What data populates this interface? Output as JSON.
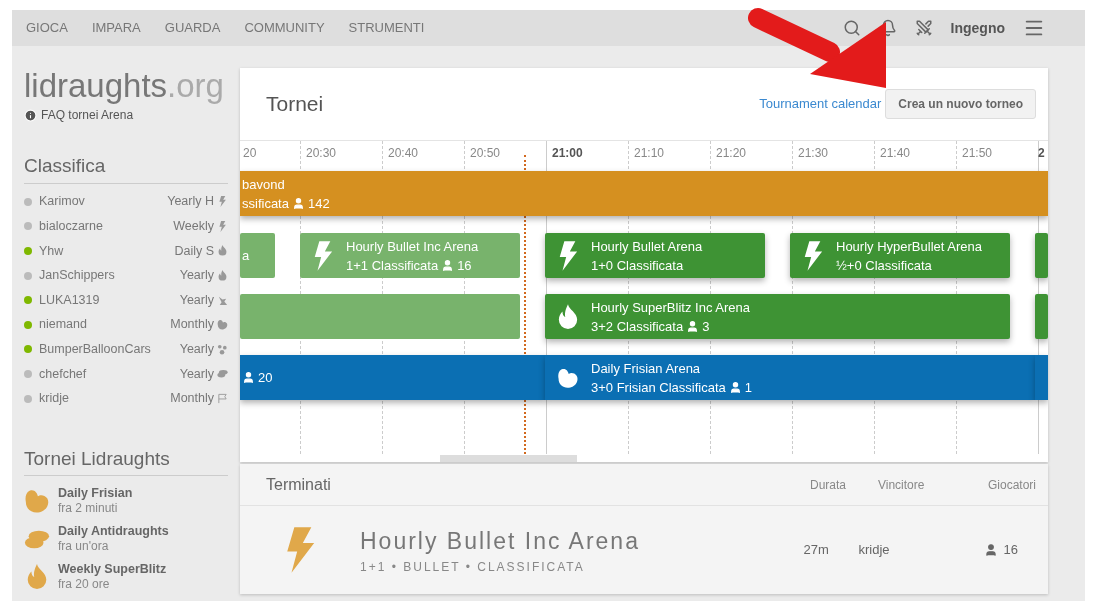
{
  "nav": {
    "items": [
      "GIOCA",
      "IMPARA",
      "GUARDA",
      "COMMUNITY",
      "STRUMENTI"
    ],
    "user": "Ingegno"
  },
  "sidebar": {
    "logo": "lidraughts",
    "logo_suffix": ".org",
    "faq": "FAQ tornei Arena",
    "leaderboard_title": "Classifica",
    "leaders": [
      {
        "name": "Karimov",
        "online": false,
        "trophy": "Yearly H",
        "kind": "bolt"
      },
      {
        "name": "bialoczarne",
        "online": false,
        "trophy": "Weekly",
        "kind": "bolt"
      },
      {
        "name": "Yhw",
        "online": true,
        "trophy": "Daily S",
        "kind": "flame"
      },
      {
        "name": "JanSchippers",
        "online": false,
        "trophy": "Yearly",
        "kind": "flame"
      },
      {
        "name": "LUKA1319",
        "online": true,
        "trophy": "Yearly",
        "kind": "rabbit"
      },
      {
        "name": "niemand",
        "online": true,
        "trophy": "Monthly",
        "kind": "frisian"
      },
      {
        "name": "BumperBalloonCars",
        "online": true,
        "trophy": "Yearly",
        "kind": "dots"
      },
      {
        "name": "chefchef",
        "online": false,
        "trophy": "Yearly",
        "kind": "anti"
      },
      {
        "name": "kridje",
        "online": false,
        "trophy": "Monthly",
        "kind": "flag"
      }
    ],
    "tournaments_title": "Tornei Lidraughts",
    "tournaments": [
      {
        "name": "Daily Frisian",
        "when": "fra 2 minuti",
        "kind": "frisian"
      },
      {
        "name": "Daily Antidraughts",
        "when": "fra un'ora",
        "kind": "anti"
      },
      {
        "name": "Weekly SuperBlitz",
        "when": "fra 20 ore",
        "kind": "flame"
      }
    ]
  },
  "main": {
    "title": "Tornei",
    "calendar_link": "Tournament calendar",
    "create_button": "Crea un nuovo torneo",
    "ticks": [
      {
        "label": "20",
        "kind": "cut"
      },
      {
        "label": "20:30",
        "kind": "minor"
      },
      {
        "label": "20:40",
        "kind": "minor"
      },
      {
        "label": "20:50",
        "kind": "minor"
      },
      {
        "label": "21:00",
        "kind": "hour"
      },
      {
        "label": "21:10",
        "kind": "minor"
      },
      {
        "label": "21:20",
        "kind": "minor"
      },
      {
        "label": "21:30",
        "kind": "minor"
      },
      {
        "label": "21:40",
        "kind": "minor"
      },
      {
        "label": "21:50",
        "kind": "minor"
      },
      {
        "label": "2",
        "kind": "hour"
      }
    ],
    "lanes": [
      {
        "events": [
          {
            "name": "bavond",
            "info": "ssificata",
            "players": "142",
            "finished": false,
            "color": "#d59020",
            "kind": "plain"
          }
        ]
      },
      {
        "events": [
          {
            "name": "a",
            "finished": true,
            "color": "#78b36c",
            "kind": "plain"
          },
          {
            "name": "Hourly Bullet Inc Arena",
            "info": "1+1 Classificata",
            "players": "16",
            "finished": true,
            "color": "#78b36c",
            "kind": "bolt"
          },
          {
            "name": "Hourly Bullet Arena",
            "info": "1+0 Classificata",
            "finished": false,
            "color": "#3e9334",
            "kind": "bolt"
          },
          {
            "name": "Hourly HyperBullet Arena",
            "info": "½+0 Classificata",
            "finished": false,
            "color": "#3e9334",
            "kind": "bolt"
          },
          {
            "finished": false,
            "color": "#3e9334",
            "kind": "plain"
          }
        ]
      },
      {
        "events": [
          {
            "finished": true,
            "color": "#78b36c",
            "kind": "plain"
          },
          {
            "name": "Hourly SuperBlitz Inc Arena",
            "info": "3+2 Classificata",
            "players": "3",
            "finished": false,
            "color": "#3e9334",
            "kind": "flame"
          },
          {
            "finished": false,
            "color": "#3e9334",
            "kind": "plain"
          }
        ]
      },
      {
        "events": [
          {
            "players": "20",
            "finished": false,
            "color": "#0b6fb3",
            "kind": "plain"
          },
          {
            "name": "Daily Frisian Arena",
            "info": "3+0 Frisian Classificata",
            "players": "1",
            "finished": false,
            "color": "#0b6fb3",
            "kind": "frisian"
          },
          {
            "finished": false,
            "color": "#0b6fb3",
            "kind": "plain"
          }
        ]
      }
    ]
  },
  "finished": {
    "title": "Terminati",
    "columns": [
      "Durata",
      "Vincitore",
      "Giocatori"
    ],
    "rows": [
      {
        "name": "Hourly Bullet Inc Arena",
        "details": "1+1 • BULLET • CLASSIFICATA",
        "duration": "27m",
        "winner": "kridje",
        "players": "16",
        "kind": "bolt"
      }
    ]
  }
}
